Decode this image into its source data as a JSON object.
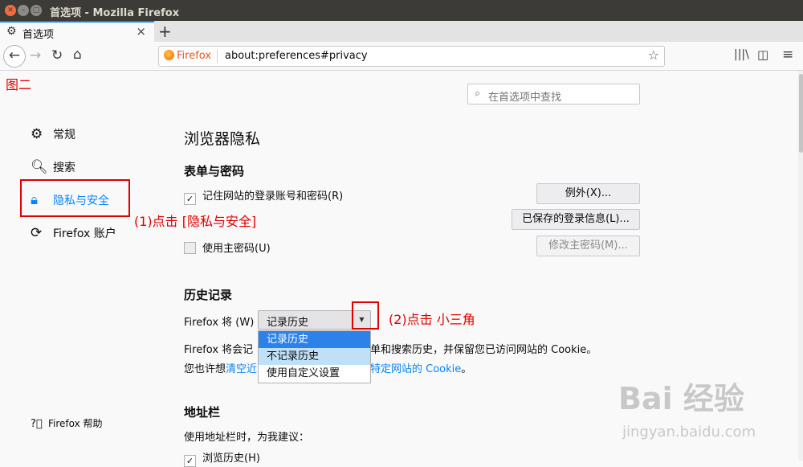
{
  "window": {
    "title": "首选项 - Mozilla Firefox"
  },
  "tab": {
    "label": "首选项",
    "close": "×",
    "newtab": "+"
  },
  "urlbar": {
    "brand": "Firefox",
    "url": "about:preferences#privacy"
  },
  "page_annotation": "图二",
  "search": {
    "placeholder": "在首选项中查找"
  },
  "sidebar": {
    "items": [
      {
        "label": "常规",
        "icon": "gear-icon"
      },
      {
        "label": "搜索",
        "icon": "search-icon"
      },
      {
        "label": "隐私与安全",
        "icon": "lock-icon"
      },
      {
        "label": "Firefox 账户",
        "icon": "sync-icon"
      }
    ],
    "help": "Firefox 帮助"
  },
  "annotations": {
    "step1": "(1)点击 [隐私与安全]",
    "step2": "(2)点击 小三角"
  },
  "main": {
    "title": "浏览器隐私",
    "forms": {
      "heading": "表单与密码",
      "remember_logins": "记住网站的登录账号和密码(R)",
      "exceptions_btn": "例外(X)...",
      "saved_logins_btn": "已保存的登录信息(L)...",
      "master_password": "使用主密码(U)",
      "change_master_btn": "修改主密码(M)..."
    },
    "history": {
      "heading": "历史记录",
      "label": "Firefox 将 (W)",
      "selected": "记录历史",
      "options": [
        "记录历史",
        "不记录历史",
        "使用自定义设置"
      ],
      "desc_start": "Firefox 将会记",
      "desc_end": "单和搜索历史，并保留您已访问网站的 Cookie。",
      "might_want": "您也许想",
      "clear_link": "清空近",
      "cookie_link": "特定网站的 Cookie",
      "period": "。"
    },
    "addressbar": {
      "heading": "地址栏",
      "desc": "使用地址栏时，为我建议：",
      "browsing_history": "浏览历史(H)"
    }
  },
  "watermark": {
    "brand": "Bai 经验",
    "url": "jingyan.baidu.com"
  }
}
